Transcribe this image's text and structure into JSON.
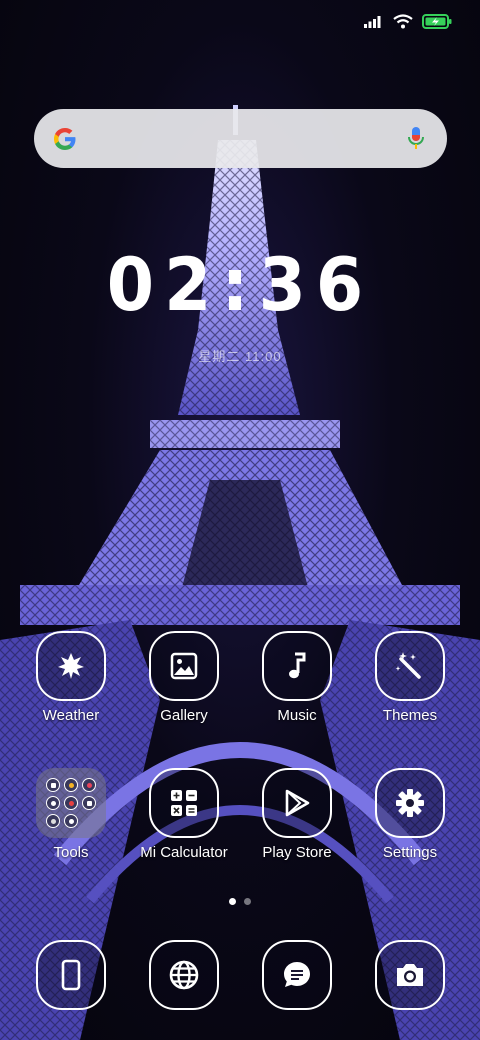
{
  "status": {
    "signal_icon": "signal-icon",
    "wifi_icon": "wifi-icon",
    "battery_icon": "battery-charging-icon",
    "battery_color": "#36d15a"
  },
  "search": {
    "logo": "google-logo",
    "mic_icon": "mic-icon"
  },
  "clock": {
    "time": "02:36",
    "date": "星期二 11:00"
  },
  "apps": [
    {
      "label": "Weather",
      "icon": "weather-icon"
    },
    {
      "label": "Gallery",
      "icon": "gallery-icon"
    },
    {
      "label": "Music",
      "icon": "music-icon"
    },
    {
      "label": "Themes",
      "icon": "themes-icon"
    },
    {
      "label": "Tools",
      "icon": "folder-icon"
    },
    {
      "label": "Mi Calculator",
      "icon": "calculator-icon"
    },
    {
      "label": "Play Store",
      "icon": "play-store-icon"
    },
    {
      "label": "Settings",
      "icon": "settings-icon"
    }
  ],
  "page_indicator": {
    "current": 1,
    "total": 2
  },
  "dock": [
    {
      "icon": "phone-icon"
    },
    {
      "icon": "browser-icon"
    },
    {
      "icon": "messages-icon"
    },
    {
      "icon": "camera-icon"
    }
  ],
  "colors": {
    "wallpaper_glow": "#8c8cff",
    "icon_outline": "#ffffff"
  }
}
